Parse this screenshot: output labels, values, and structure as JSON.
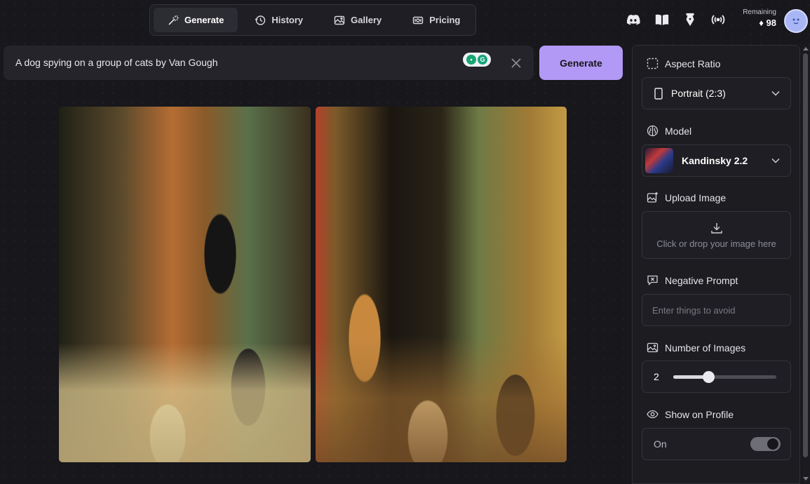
{
  "nav": {
    "tabs": [
      {
        "label": "Generate",
        "icon": "magic-wand-icon",
        "active": true
      },
      {
        "label": "History",
        "icon": "history-icon",
        "active": false
      },
      {
        "label": "Gallery",
        "icon": "gallery-icon",
        "active": false
      },
      {
        "label": "Pricing",
        "icon": "pricing-icon",
        "active": false
      }
    ]
  },
  "topright": {
    "icons": [
      "discord-icon",
      "book-icon",
      "pen-nib-icon",
      "broadcast-icon"
    ],
    "remaining_label": "Remaining",
    "remaining_value": "98",
    "remaining_icon": "diamond-icon"
  },
  "prompt": {
    "value": "A dog spying on a group of cats by Van Gough",
    "generate_label": "Generate"
  },
  "images": [
    {
      "name": "generated-image-1",
      "description_icon": "artwork"
    },
    {
      "name": "generated-image-2",
      "description_icon": "artwork"
    }
  ],
  "panel": {
    "aspect_ratio": {
      "title": "Aspect Ratio",
      "value": "Portrait (2:3)"
    },
    "model": {
      "title": "Model",
      "value": "Kandinsky 2.2"
    },
    "upload": {
      "title": "Upload Image",
      "hint": "Click or drop your image here"
    },
    "negative": {
      "title": "Negative Prompt",
      "placeholder": "Enter things to avoid"
    },
    "num_images": {
      "title": "Number of Images",
      "value": "2",
      "slider_fraction": 0.34
    },
    "profile": {
      "title": "Show on Profile",
      "value": "On",
      "enabled": true
    }
  },
  "colors": {
    "accent": "#b299f5",
    "background": "#17171c",
    "panel": "#1c1c21"
  }
}
